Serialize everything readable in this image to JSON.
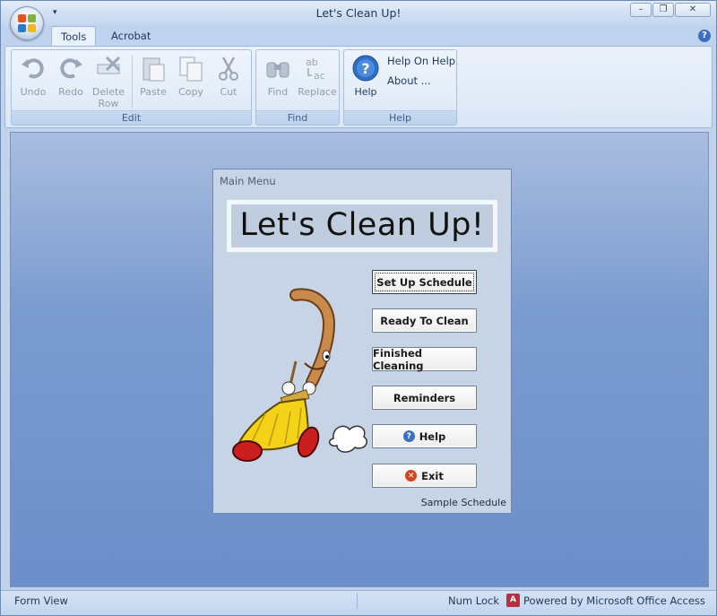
{
  "window": {
    "title": "Let's Clean Up!"
  },
  "title_controls": {
    "minimize": "–",
    "restore": "❐",
    "close": "✕"
  },
  "tabs": [
    {
      "label": "Tools",
      "active": true
    },
    {
      "label": "Acrobat",
      "active": false
    }
  ],
  "ribbon": {
    "edit_group": {
      "label": "Edit",
      "undo": "Undo",
      "redo": "Redo",
      "delete_row_l1": "Delete",
      "delete_row_l2": "Row",
      "paste": "Paste",
      "copy": "Copy",
      "cut": "Cut"
    },
    "find_group": {
      "label": "Find",
      "find": "Find",
      "replace": "Replace"
    },
    "help_group": {
      "label": "Help",
      "help": "Help",
      "help_on_help": "Help On Help",
      "about": "About ..."
    }
  },
  "dialog": {
    "caption": "Main Menu",
    "banner": "Let's Clean Up!",
    "buttons": [
      {
        "label": "Set Up Schedule"
      },
      {
        "label": "Ready To Clean"
      },
      {
        "label": "Finished Cleaning"
      },
      {
        "label": "Reminders"
      },
      {
        "label": "Help"
      },
      {
        "label": "Exit"
      }
    ],
    "footer": "Sample Schedule"
  },
  "statusbar": {
    "view": "Form View",
    "num_lock": "Num Lock",
    "powered": "Powered by Microsoft Office Access"
  },
  "colors": {
    "workspace": "#7a9bcf",
    "dialog_bg": "#c7d4e6",
    "ribbon_bg": "#dbe7f6",
    "broom_yellow": "#f3d217",
    "broom_shoe": "#cc1e1e"
  }
}
